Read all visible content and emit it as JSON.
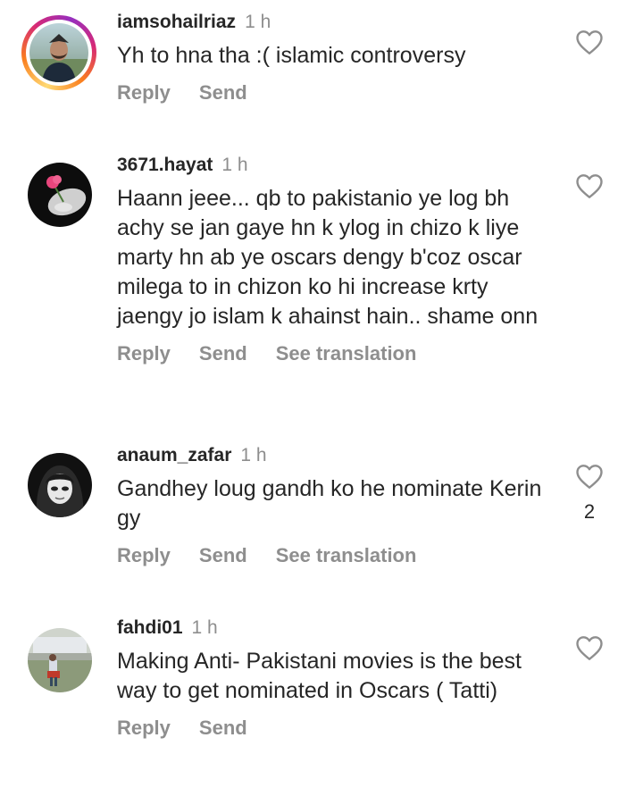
{
  "colors": {
    "text": "#262626",
    "secondary": "#8e8e8e",
    "background": "#ffffff",
    "story_ring": [
      "#feda75",
      "#fa7e1e",
      "#d62976",
      "#962fbf"
    ]
  },
  "comments": [
    {
      "username": "iamsohailriaz",
      "time": "1 h",
      "text": "Yh to hna tha :( islamic controversy",
      "actions": [
        "Reply",
        "Send"
      ],
      "like_icon": "heart-outline-icon",
      "like_count": "",
      "has_story_ring": true
    },
    {
      "username": "3671.hayat",
      "time": "1 h",
      "text": "Haann jeee... qb to pakistanio ye log bh achy se jan gaye hn k ylog in chizo k liye marty hn ab ye oscars dengy b'coz oscar milega to in chizon ko hi increase krty jaengy jo islam k ahainst hain.. shame onn",
      "actions": [
        "Reply",
        "Send",
        "See translation"
      ],
      "like_icon": "heart-outline-icon",
      "like_count": "",
      "has_story_ring": false
    },
    {
      "username": "anaum_zafar",
      "time": "1 h",
      "text": "Gandhey loug gandh ko he nominate Kerin gy",
      "actions": [
        "Reply",
        "Send",
        "See translation"
      ],
      "like_icon": "heart-outline-icon",
      "like_count": "2",
      "has_story_ring": false
    },
    {
      "username": "fahdi01",
      "time": "1 h",
      "text": "Making Anti- Pakistani movies is the best way to get nominated in Oscars ( Tatti)",
      "actions": [
        "Reply",
        "Send"
      ],
      "like_icon": "heart-outline-icon",
      "like_count": "",
      "has_story_ring": false
    }
  ]
}
